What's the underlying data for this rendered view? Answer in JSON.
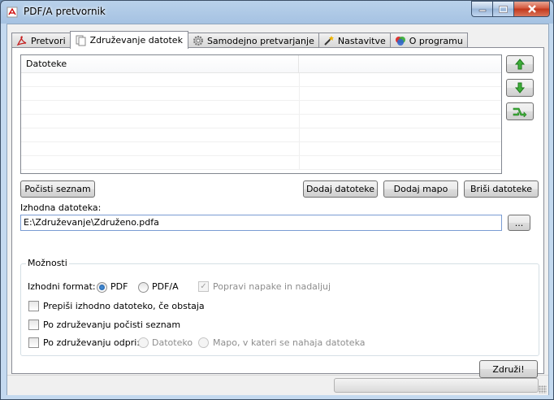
{
  "window": {
    "title": "PDF/A pretvornik",
    "controls": {
      "minimize_icon": "minimize-icon",
      "maximize_icon": "maximize-icon",
      "close_icon": "close-icon"
    }
  },
  "tabs": [
    {
      "label": "Pretvori",
      "icon": "pdf-icon",
      "active": false
    },
    {
      "label": "Združevanje datotek",
      "icon": "documents-icon",
      "active": true
    },
    {
      "label": "Samodejno pretvarjanje",
      "icon": "gear-icon",
      "active": false
    },
    {
      "label": "Nastavitve",
      "icon": "magic-wand-icon",
      "active": false
    },
    {
      "label": "O programu",
      "icon": "info-icon",
      "active": false
    }
  ],
  "file_list": {
    "columns": [
      "Datoteke",
      ""
    ],
    "rows": []
  },
  "side_buttons": {
    "up_icon": "arrow-up-icon",
    "down_icon": "arrow-down-icon",
    "shuffle_icon": "shuffle-icon"
  },
  "buttons": {
    "clear_list": "Počisti seznam",
    "add_files": "Dodaj datoteke",
    "add_folder": "Dodaj mapo",
    "delete_files": "Briši datoteke",
    "browse": "...",
    "merge": "Združi!"
  },
  "output": {
    "label": "Izhodna datoteka:",
    "value": "E:\\Združevanje\\Združeno.pdfa"
  },
  "options": {
    "group_title": "Možnosti",
    "format_label": "Izhodni format:",
    "format_pdf": "PDF",
    "format_pdfa": "PDF/A",
    "format_selected": "PDF",
    "fix_errors": "Popravi napake in nadaljuj",
    "overwrite": "Prepiši izhodno datoteko, če obstaja",
    "clear_after": "Po združevanju počisti seznam",
    "open_after": "Po združevanju odpri:",
    "open_file": "Datoteko",
    "open_folder": "Mapo, v kateri se nahaja datoteka"
  },
  "status": {
    "progress": 0
  }
}
